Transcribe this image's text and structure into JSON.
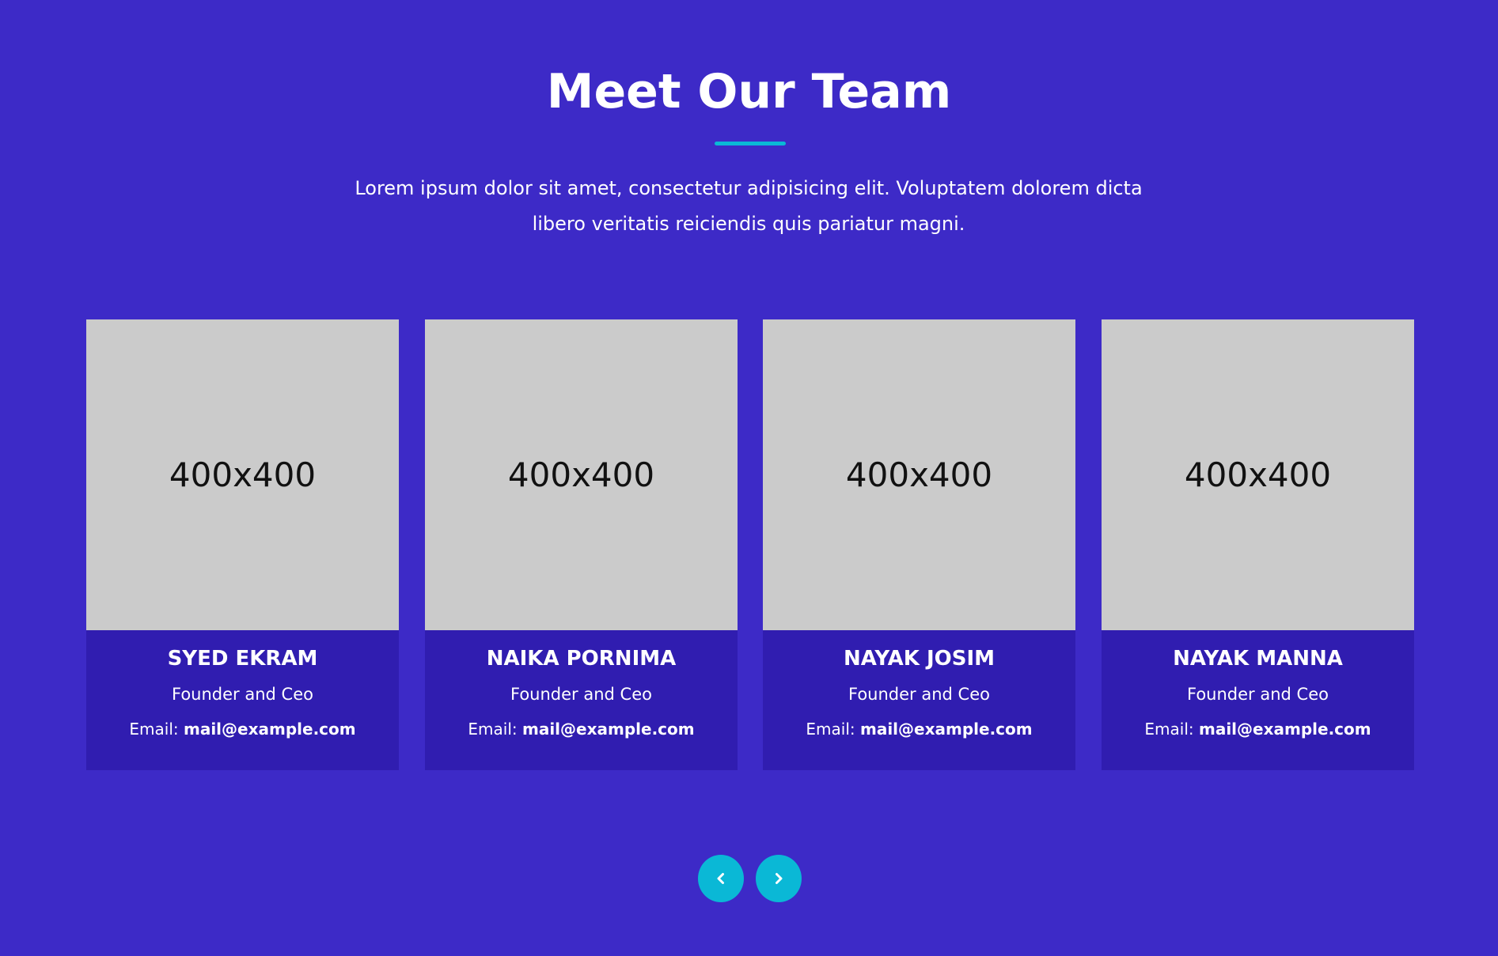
{
  "section": {
    "title": "Meet Our Team",
    "intro": "Lorem ipsum dolor sit amet, consectetur adipisicing elit. Voluptatem dolorem dicta libero veritatis reiciendis quis pariatur magni."
  },
  "team": [
    {
      "image_text": "400x400",
      "name": "SYED EKRAM",
      "role": "Founder and Ceo",
      "email_label": "Email:",
      "email": "mail@example.com"
    },
    {
      "image_text": "400x400",
      "name": "NAIKA PORNIMA",
      "role": "Founder and Ceo",
      "email_label": "Email:",
      "email": "mail@example.com"
    },
    {
      "image_text": "400x400",
      "name": "NAYAK JOSIM",
      "role": "Founder and Ceo",
      "email_label": "Email:",
      "email": "mail@example.com"
    },
    {
      "image_text": "400x400",
      "name": "NAYAK MANNA",
      "role": "Founder and Ceo",
      "email_label": "Email:",
      "email": "mail@example.com"
    }
  ],
  "carousel": {
    "prev_icon": "chevron-left-icon",
    "next_icon": "chevron-right-icon"
  },
  "colors": {
    "background": "#3d2ac7",
    "card_body": "#301db0",
    "accent": "#0ab8d6",
    "image_placeholder": "#cbcbcb"
  }
}
